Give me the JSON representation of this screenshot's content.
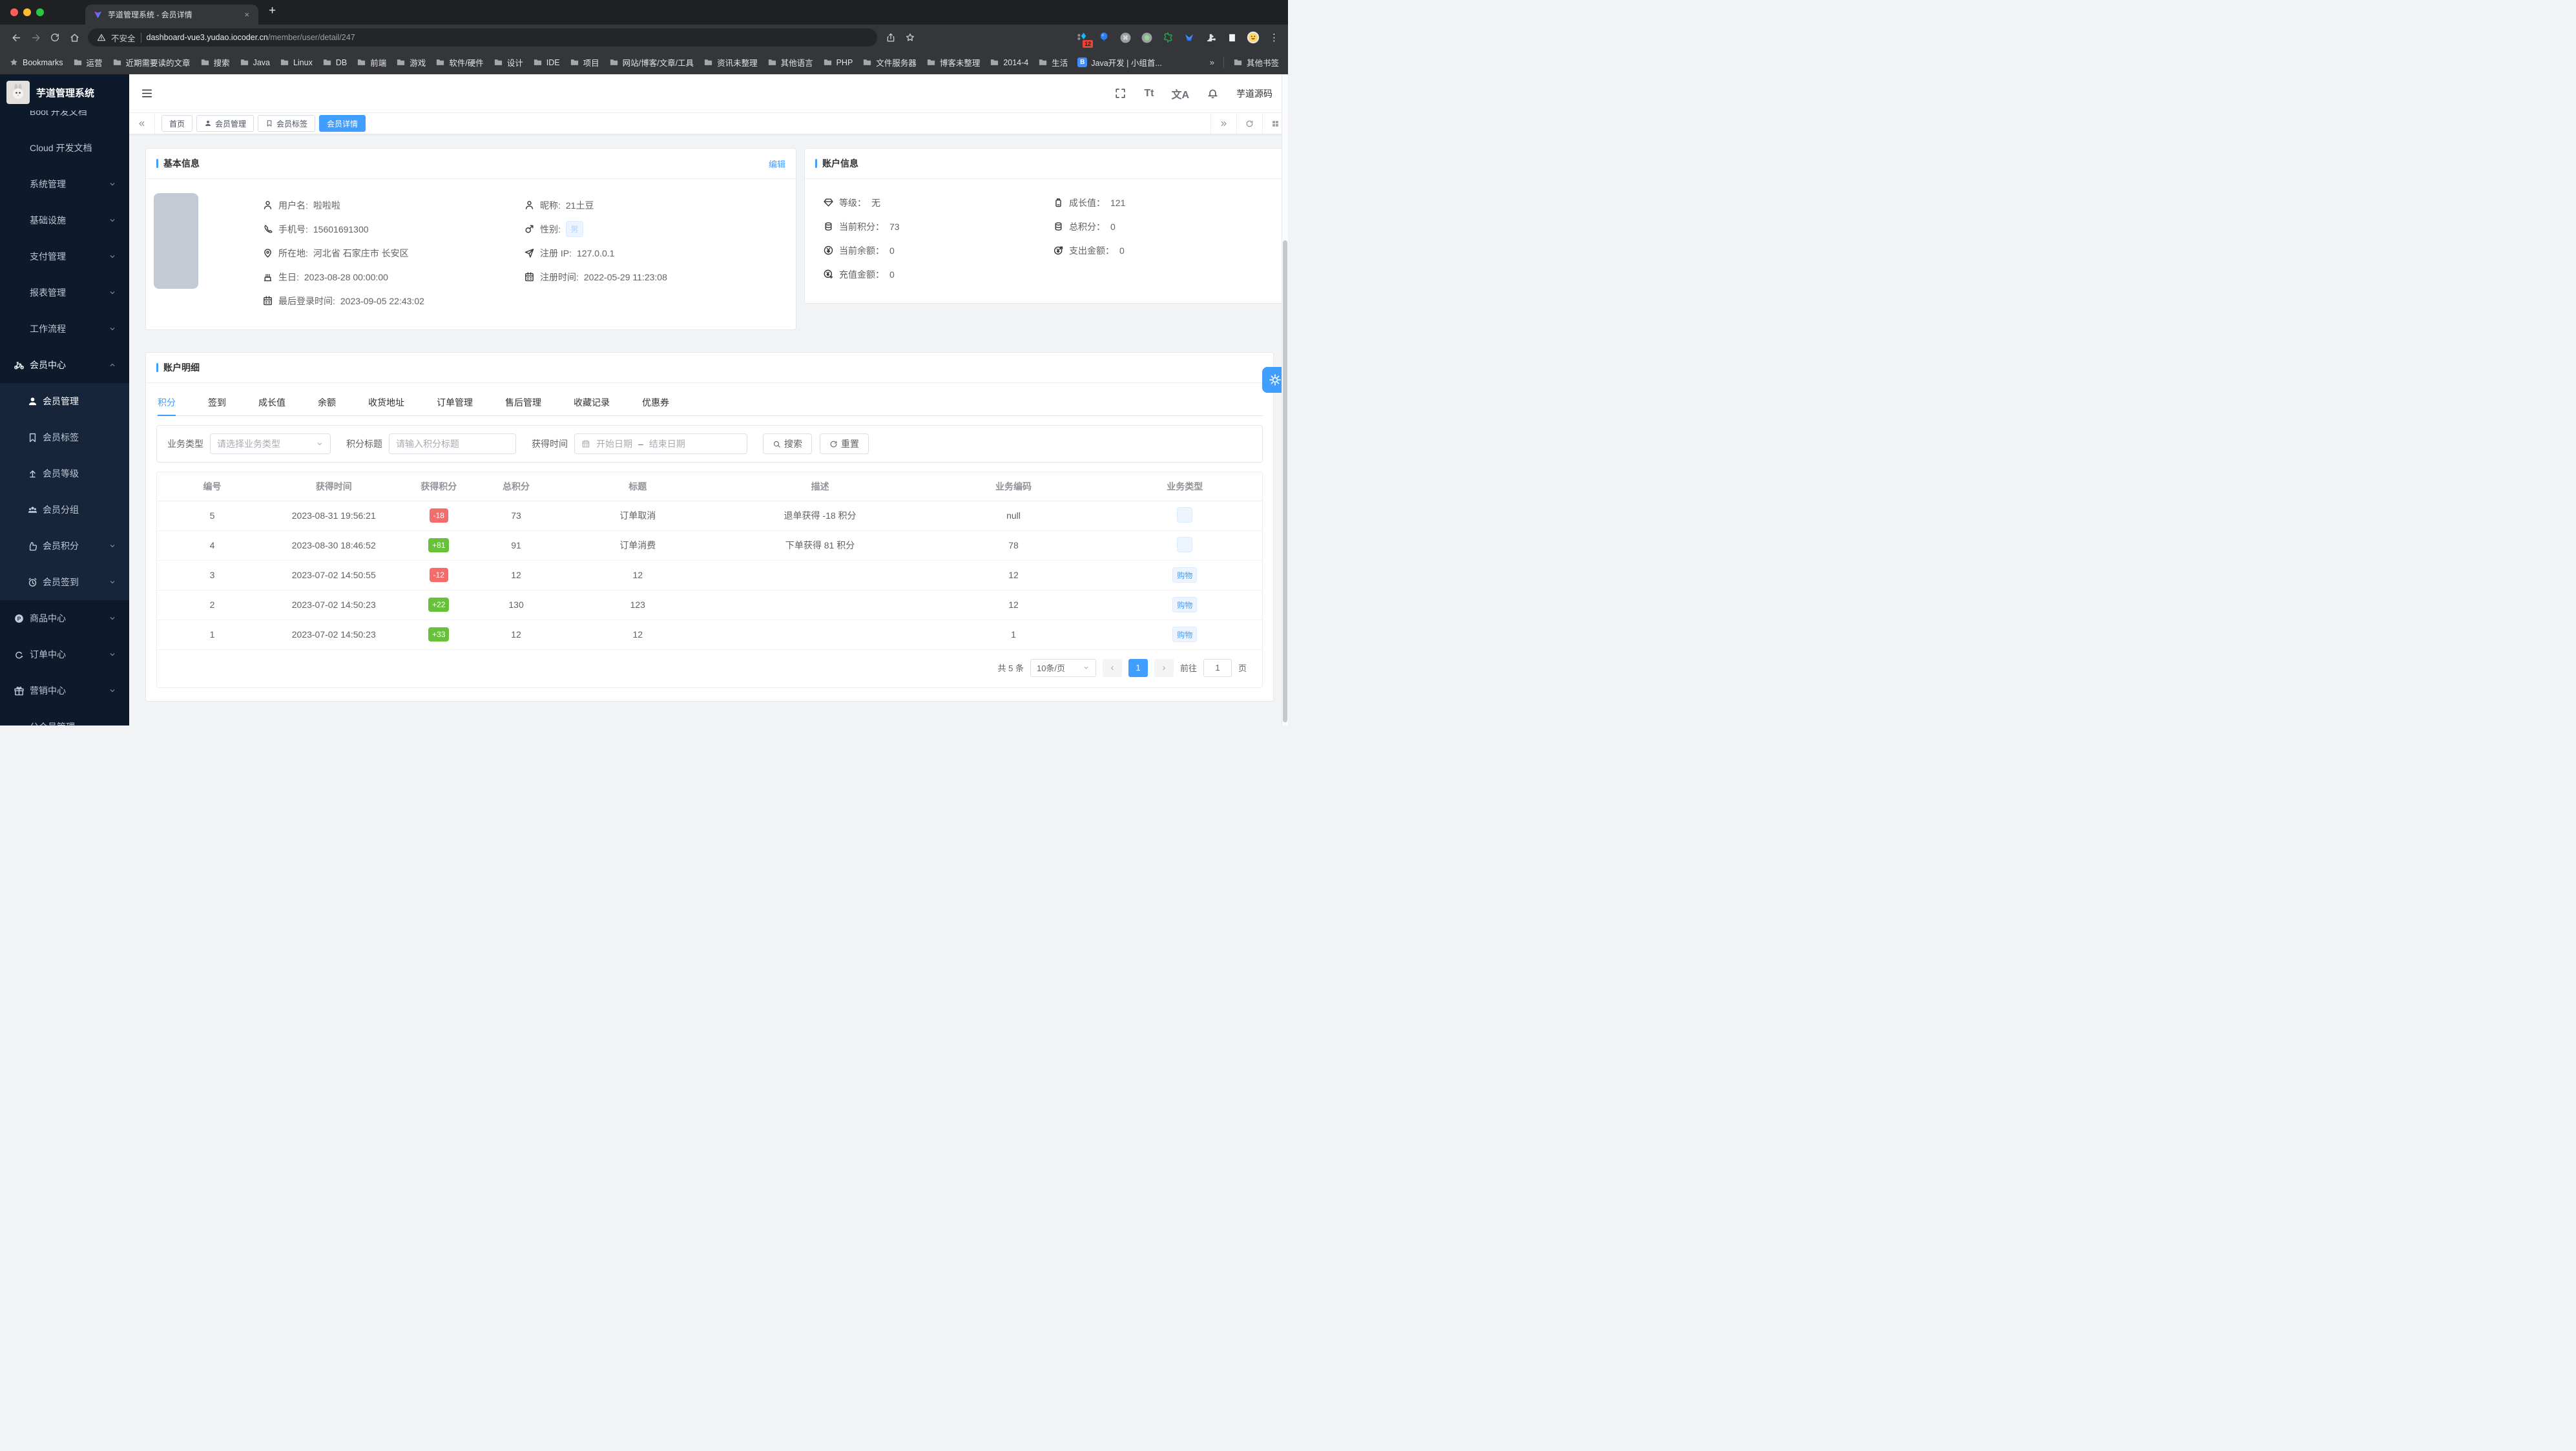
{
  "chrome": {
    "tab": {
      "title": "芋道管理系统 - 会员详情",
      "close": "×",
      "new_tab": "+"
    },
    "url": {
      "security": "不安全",
      "host": "dashboard-vue3.yudao.iocoder.cn",
      "path": "/member/user/detail/247"
    },
    "ext_badge": "12",
    "menu_dots": "⋮",
    "bookmarks_label": "Bookmarks",
    "bookmarks": [
      {
        "label": "运营",
        "isFolder": true
      },
      {
        "label": "近期需要读的文章",
        "isFolder": true
      },
      {
        "label": "搜索",
        "isFolder": true
      },
      {
        "label": "Java",
        "isFolder": true
      },
      {
        "label": "Linux",
        "isFolder": true
      },
      {
        "label": "DB",
        "isFolder": true
      },
      {
        "label": "前端",
        "isFolder": true
      },
      {
        "label": "游戏",
        "isFolder": true
      },
      {
        "label": "软件/硬件",
        "isFolder": true
      },
      {
        "label": "设计",
        "isFolder": true
      },
      {
        "label": "IDE",
        "isFolder": true
      },
      {
        "label": "项目",
        "isFolder": true
      },
      {
        "label": "网站/博客/文章/工具",
        "isFolder": true
      },
      {
        "label": "资讯未整理",
        "isFolder": true
      },
      {
        "label": "其他语言",
        "isFolder": true
      },
      {
        "label": "PHP",
        "isFolder": true
      },
      {
        "label": "文件服务器",
        "isFolder": true
      },
      {
        "label": "博客未整理",
        "isFolder": true
      },
      {
        "label": "2014-4",
        "isFolder": true
      },
      {
        "label": "生活",
        "isFolder": true
      },
      {
        "label": "Java开发 | 小组首...",
        "isFolder": false,
        "isSite": true,
        "siteInitial": "B"
      }
    ],
    "bookmarks_overflow": "»",
    "other_bookmarks": "其他书签"
  },
  "sidebar": {
    "title": "芋道管理系统",
    "items": [
      {
        "label": "Boot 开发文档",
        "cls": "clip"
      },
      {
        "label": "Cloud 开发文档"
      },
      {
        "label": "系统管理",
        "chev": "1"
      },
      {
        "label": "基础设施",
        "chev": "1"
      },
      {
        "label": "支付管理",
        "chev": "1"
      },
      {
        "label": "报表管理",
        "chev": "1"
      },
      {
        "label": "工作流程",
        "chev": "1"
      },
      {
        "label": "会员中心",
        "icon": "#i-bike",
        "chev": "1",
        "chevCls": "up",
        "cls": "parent"
      },
      {
        "label": "会员管理",
        "cls": "sub active",
        "icon": "#i-user-f"
      },
      {
        "label": "会员标签",
        "cls": "sub",
        "icon": "#i-bookmark"
      },
      {
        "label": "会员等级",
        "cls": "sub",
        "icon": "#i-level"
      },
      {
        "label": "会员分组",
        "cls": "sub",
        "icon": "#i-users"
      },
      {
        "label": "会员积分",
        "cls": "sub",
        "icon": "#i-thumb",
        "chev": "1"
      },
      {
        "label": "会员签到",
        "cls": "sub",
        "icon": "#i-clock",
        "chev": "1"
      },
      {
        "label": "商品中心",
        "icon": "#i-pcircle",
        "chev": "1"
      },
      {
        "label": "订单中心",
        "icon": "#i-ecircle",
        "chev": "1"
      },
      {
        "label": "营销中心",
        "icon": "#i-gift",
        "chev": "1"
      },
      {
        "label": "公众号管理",
        "chev": "1"
      }
    ]
  },
  "header": {
    "user": "芋道源码",
    "font_icon": "Tt",
    "lang_icon": "文A"
  },
  "tabbar": {
    "tabs": [
      {
        "label": "首页"
      },
      {
        "label": "会员管理",
        "icon": "#i-user-f"
      },
      {
        "label": "会员标签",
        "icon": "#i-bookmark"
      },
      {
        "label": "会员详情",
        "cls": "active"
      }
    ]
  },
  "basic": {
    "title": "基本信息",
    "edit": "编辑",
    "left": [
      {
        "icon": "#i-person",
        "label": "用户名:",
        "value": "啦啦啦"
      },
      {
        "icon": "#i-phone",
        "label": "手机号:",
        "value": "15601691300"
      },
      {
        "icon": "#i-pin",
        "label": "所在地:",
        "value": "河北省 石家庄市 长安区"
      },
      {
        "icon": "#i-cake",
        "label": "生日:",
        "value": "2023-08-28 00:00:00"
      },
      {
        "icon": "#i-cal",
        "label": "最后登录时间:",
        "value": "2023-09-05 22:43:02"
      }
    ],
    "right": [
      {
        "icon": "#i-person",
        "label": "昵称:",
        "value": "21土豆"
      },
      {
        "icon": "#i-gender",
        "label": "性别:",
        "value": "",
        "tag": "男"
      },
      {
        "icon": "#i-send",
        "label": "注册 IP:",
        "value": "127.0.0.1"
      },
      {
        "icon": "#i-cal",
        "label": "注册时间:",
        "value": "2022-05-29 11:23:08"
      }
    ]
  },
  "account": {
    "title": "账户信息",
    "left": [
      {
        "icon": "#i-diamond",
        "label": "等级：",
        "value": "无"
      },
      {
        "icon": "#i-coins",
        "label": "当前积分：",
        "value": "73"
      },
      {
        "icon": "#i-yuan",
        "label": "当前余额：",
        "value": "0"
      },
      {
        "icon": "#i-yuan-in",
        "label": "充值金额：",
        "value": "0"
      }
    ],
    "right": [
      {
        "icon": "#i-growth",
        "label": "成长值：",
        "value": "121"
      },
      {
        "icon": "#i-coins",
        "label": "总积分：",
        "value": "0"
      },
      {
        "icon": "#i-yuan-out",
        "label": "支出金额：",
        "value": "0"
      }
    ]
  },
  "detail": {
    "title": "账户明细",
    "tabs": [
      {
        "label": "积分",
        "cls": "active"
      },
      {
        "label": "签到"
      },
      {
        "label": "成长值"
      },
      {
        "label": "余额"
      },
      {
        "label": "收货地址"
      },
      {
        "label": "订单管理"
      },
      {
        "label": "售后管理"
      },
      {
        "label": "收藏记录"
      },
      {
        "label": "优惠券"
      }
    ],
    "search": {
      "type_label": "业务类型",
      "type_ph": "请选择业务类型",
      "title_label": "积分标题",
      "title_ph": "请输入积分标题",
      "time_label": "获得时间",
      "start_ph": "开始日期",
      "range_sep": "–",
      "end_ph": "结束日期",
      "search_btn": "搜索",
      "reset_btn": "重置"
    },
    "table": {
      "headers": [
        {
          "label": "编号",
          "cls": "c-id"
        },
        {
          "label": "获得时间",
          "cls": "c-time"
        },
        {
          "label": "获得积分",
          "cls": "c-delta"
        },
        {
          "label": "总积分",
          "cls": "c-total"
        },
        {
          "label": "标题",
          "cls": "c-title"
        },
        {
          "label": "描述",
          "cls": "c-desc"
        },
        {
          "label": "业务编码",
          "cls": "c-code"
        },
        {
          "label": "业务类型",
          "cls": "c-type"
        }
      ],
      "rows": [
        {
          "id": "5",
          "time": "2023-08-31 19:56:21",
          "delta": "-18",
          "deltaCls": "red",
          "total": "73",
          "title": "订单取消",
          "desc": "退单获得 -18 积分",
          "code": "null",
          "type": ""
        },
        {
          "id": "4",
          "time": "2023-08-30 18:46:52",
          "delta": "+81",
          "deltaCls": "green",
          "total": "91",
          "title": "订单消费",
          "desc": "下单获得 81 积分",
          "code": "78",
          "type": ""
        },
        {
          "id": "3",
          "time": "2023-07-02 14:50:55",
          "delta": "-12",
          "deltaCls": "red",
          "total": "12",
          "title": "12",
          "desc": "",
          "code": "12",
          "type": "购物"
        },
        {
          "id": "2",
          "time": "2023-07-02 14:50:23",
          "delta": "+22",
          "deltaCls": "green",
          "total": "130",
          "title": "123",
          "desc": "",
          "code": "12",
          "type": "购物"
        },
        {
          "id": "1",
          "time": "2023-07-02 14:50:23",
          "delta": "+33",
          "deltaCls": "green",
          "total": "12",
          "title": "12",
          "desc": "",
          "code": "1",
          "type": "购物"
        }
      ]
    },
    "pagination": {
      "total": "共 5 条",
      "size": "10条/页",
      "prev": "‹",
      "page": "1",
      "next": "›",
      "goto_label": "前往",
      "goto_value": "1",
      "unit": "页"
    }
  }
}
